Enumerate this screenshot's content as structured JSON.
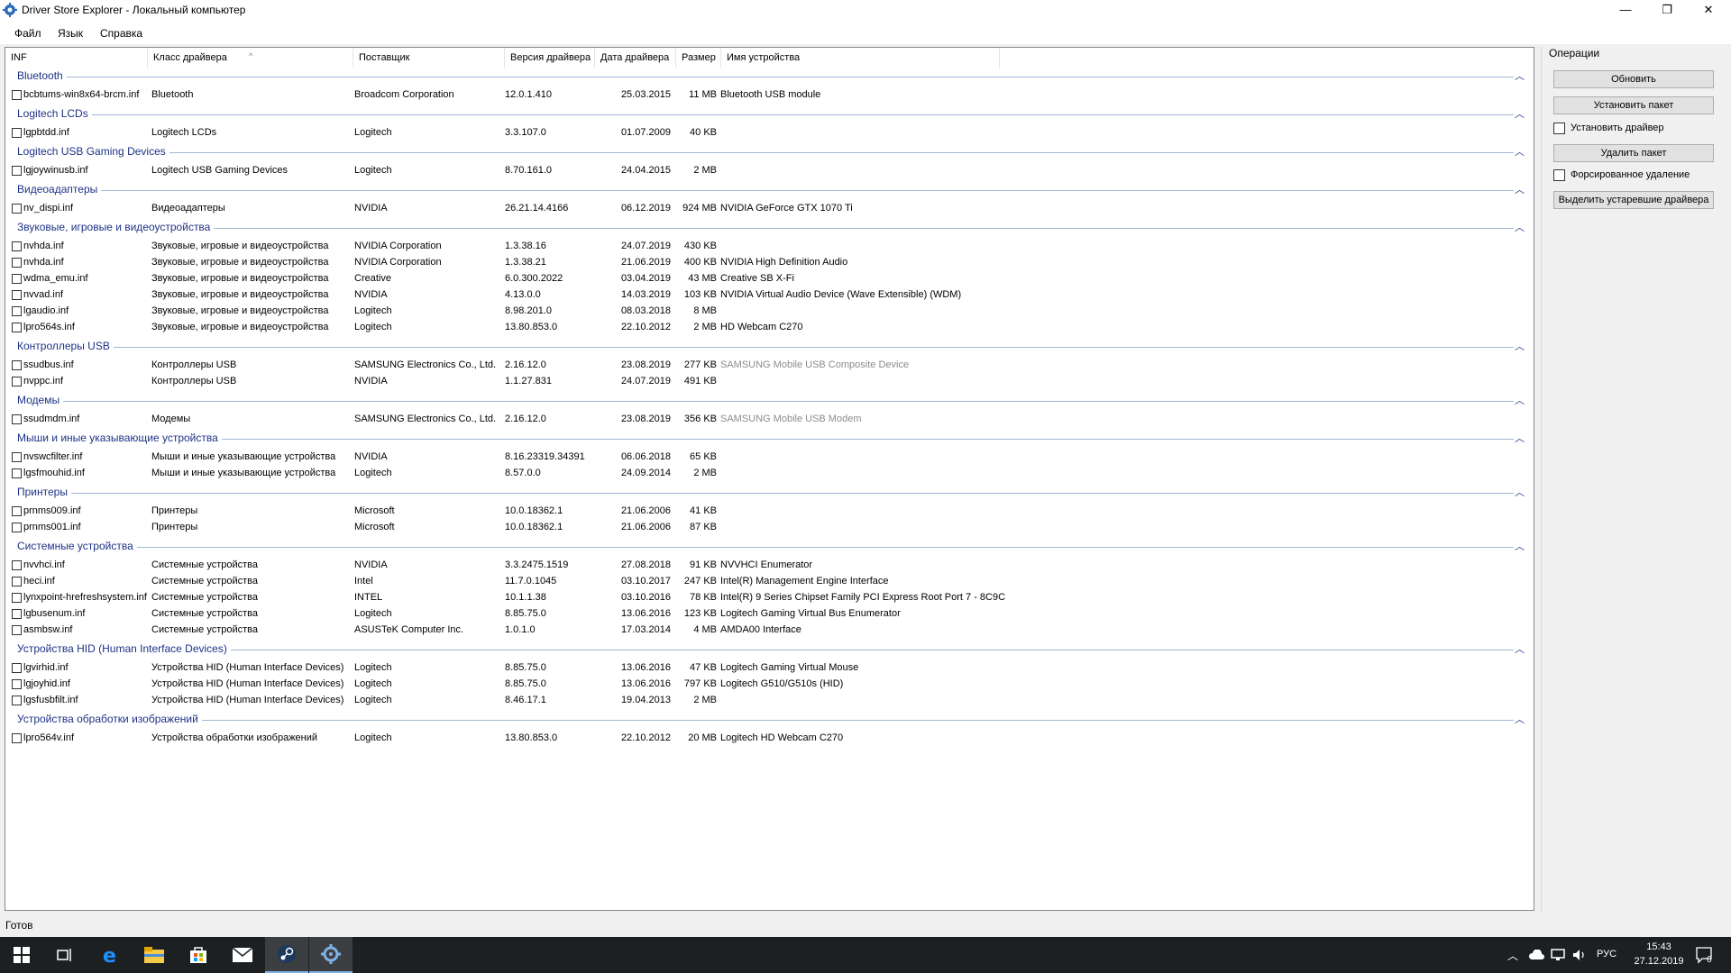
{
  "window": {
    "title": "Driver Store Explorer - Локальный компьютер",
    "min": "—",
    "max": "❐",
    "close": "✕"
  },
  "menu": [
    "Файл",
    "Язык",
    "Справка"
  ],
  "columns": [
    "INF",
    "Класс драйвера",
    "Поставщик",
    "Версия драйвера",
    "Дата драйвера",
    "Размер",
    "Имя устройства"
  ],
  "groups": [
    {
      "title": "Bluetooth",
      "rows": [
        {
          "inf": "bcbtums-win8x64-brcm.inf",
          "cls": "Bluetooth",
          "prov": "Broadcom Corporation",
          "ver": "12.0.1.410",
          "date": "25.03.2015",
          "size": "11 MB",
          "dev": "Bluetooth USB module",
          "dim": false
        }
      ]
    },
    {
      "title": "Logitech LCDs",
      "rows": [
        {
          "inf": "lgpbtdd.inf",
          "cls": "Logitech LCDs",
          "prov": "Logitech",
          "ver": "3.3.107.0",
          "date": "01.07.2009",
          "size": "40 KB",
          "dev": "",
          "dim": false
        }
      ]
    },
    {
      "title": "Logitech USB Gaming Devices",
      "rows": [
        {
          "inf": "lgjoywinusb.inf",
          "cls": "Logitech USB Gaming Devices",
          "prov": "Logitech",
          "ver": "8.70.161.0",
          "date": "24.04.2015",
          "size": "2 MB",
          "dev": "",
          "dim": false
        }
      ]
    },
    {
      "title": "Видеоадаптеры",
      "rows": [
        {
          "inf": "nv_dispi.inf",
          "cls": "Видеоадаптеры",
          "prov": "NVIDIA",
          "ver": "26.21.14.4166",
          "date": "06.12.2019",
          "size": "924 MB",
          "dev": "NVIDIA GeForce GTX 1070 Ti",
          "dim": false
        }
      ]
    },
    {
      "title": "Звуковые, игровые и видеоустройства",
      "rows": [
        {
          "inf": "nvhda.inf",
          "cls": "Звуковые, игровые и видеоустройства",
          "prov": "NVIDIA Corporation",
          "ver": "1.3.38.16",
          "date": "24.07.2019",
          "size": "430 KB",
          "dev": "",
          "dim": false
        },
        {
          "inf": "nvhda.inf",
          "cls": "Звуковые, игровые и видеоустройства",
          "prov": "NVIDIA Corporation",
          "ver": "1.3.38.21",
          "date": "21.06.2019",
          "size": "400 KB",
          "dev": "NVIDIA High Definition Audio",
          "dim": false
        },
        {
          "inf": "wdma_emu.inf",
          "cls": "Звуковые, игровые и видеоустройства",
          "prov": "Creative",
          "ver": "6.0.300.2022",
          "date": "03.04.2019",
          "size": "43 MB",
          "dev": "Creative SB X-Fi",
          "dim": false
        },
        {
          "inf": "nvvad.inf",
          "cls": "Звуковые, игровые и видеоустройства",
          "prov": "NVIDIA",
          "ver": "4.13.0.0",
          "date": "14.03.2019",
          "size": "103 KB",
          "dev": "NVIDIA Virtual Audio Device (Wave Extensible) (WDM)",
          "dim": false
        },
        {
          "inf": "lgaudio.inf",
          "cls": "Звуковые, игровые и видеоустройства",
          "prov": "Logitech",
          "ver": "8.98.201.0",
          "date": "08.03.2018",
          "size": "8 MB",
          "dev": "",
          "dim": false
        },
        {
          "inf": "lpro564s.inf",
          "cls": "Звуковые, игровые и видеоустройства",
          "prov": "Logitech",
          "ver": "13.80.853.0",
          "date": "22.10.2012",
          "size": "2 MB",
          "dev": "HD Webcam C270",
          "dim": false
        }
      ]
    },
    {
      "title": "Контроллеры USB",
      "rows": [
        {
          "inf": "ssudbus.inf",
          "cls": "Контроллеры USB",
          "prov": "SAMSUNG Electronics Co., Ltd.",
          "ver": "2.16.12.0",
          "date": "23.08.2019",
          "size": "277 KB",
          "dev": "SAMSUNG Mobile USB Composite Device",
          "dim": true
        },
        {
          "inf": "nvppc.inf",
          "cls": "Контроллеры USB",
          "prov": "NVIDIA",
          "ver": "1.1.27.831",
          "date": "24.07.2019",
          "size": "491 KB",
          "dev": "",
          "dim": false
        }
      ]
    },
    {
      "title": "Модемы",
      "rows": [
        {
          "inf": "ssudmdm.inf",
          "cls": "Модемы",
          "prov": "SAMSUNG Electronics Co., Ltd.",
          "ver": "2.16.12.0",
          "date": "23.08.2019",
          "size": "356 KB",
          "dev": "SAMSUNG Mobile USB Modem",
          "dim": true
        }
      ]
    },
    {
      "title": "Мыши и иные указывающие устройства",
      "rows": [
        {
          "inf": "nvswcfilter.inf",
          "cls": "Мыши и иные указывающие устройства",
          "prov": "NVIDIA",
          "ver": "8.16.23319.34391",
          "date": "06.06.2018",
          "size": "65 KB",
          "dev": "",
          "dim": false
        },
        {
          "inf": "lgsfmouhid.inf",
          "cls": "Мыши и иные указывающие устройства",
          "prov": "Logitech",
          "ver": "8.57.0.0",
          "date": "24.09.2014",
          "size": "2 MB",
          "dev": "",
          "dim": false
        }
      ]
    },
    {
      "title": "Принтеры",
      "rows": [
        {
          "inf": "prnms009.inf",
          "cls": "Принтеры",
          "prov": "Microsoft",
          "ver": "10.0.18362.1",
          "date": "21.06.2006",
          "size": "41 KB",
          "dev": "",
          "dim": false
        },
        {
          "inf": "prnms001.inf",
          "cls": "Принтеры",
          "prov": "Microsoft",
          "ver": "10.0.18362.1",
          "date": "21.06.2006",
          "size": "87 KB",
          "dev": "",
          "dim": false
        }
      ]
    },
    {
      "title": "Системные устройства",
      "rows": [
        {
          "inf": "nvvhci.inf",
          "cls": "Системные устройства",
          "prov": "NVIDIA",
          "ver": "3.3.2475.1519",
          "date": "27.08.2018",
          "size": "91 KB",
          "dev": "NVVHCI Enumerator",
          "dim": false
        },
        {
          "inf": "heci.inf",
          "cls": "Системные устройства",
          "prov": "Intel",
          "ver": "11.7.0.1045",
          "date": "03.10.2017",
          "size": "247 KB",
          "dev": "Intel(R) Management Engine Interface",
          "dim": false
        },
        {
          "inf": "lynxpoint-hrefreshsystem.inf",
          "cls": "Системные устройства",
          "prov": "INTEL",
          "ver": "10.1.1.38",
          "date": "03.10.2016",
          "size": "78 KB",
          "dev": "Intel(R) 9 Series Chipset Family PCI Express Root Port 7 - 8C9C",
          "dim": false
        },
        {
          "inf": "lgbusenum.inf",
          "cls": "Системные устройства",
          "prov": "Logitech",
          "ver": "8.85.75.0",
          "date": "13.06.2016",
          "size": "123 KB",
          "dev": "Logitech Gaming Virtual Bus Enumerator",
          "dim": false
        },
        {
          "inf": "asmbsw.inf",
          "cls": "Системные устройства",
          "prov": "ASUSTeK Computer Inc.",
          "ver": "1.0.1.0",
          "date": "17.03.2014",
          "size": "4 MB",
          "dev": "AMDA00 Interface",
          "dim": false
        }
      ]
    },
    {
      "title": "Устройства HID (Human Interface Devices)",
      "rows": [
        {
          "inf": "lgvirhid.inf",
          "cls": "Устройства HID (Human Interface Devices)",
          "prov": "Logitech",
          "ver": "8.85.75.0",
          "date": "13.06.2016",
          "size": "47 KB",
          "dev": "Logitech Gaming Virtual Mouse",
          "dim": false
        },
        {
          "inf": "lgjoyhid.inf",
          "cls": "Устройства HID (Human Interface Devices)",
          "prov": "Logitech",
          "ver": "8.85.75.0",
          "date": "13.06.2016",
          "size": "797 KB",
          "dev": "Logitech G510/G510s (HID)",
          "dim": false
        },
        {
          "inf": "lgsfusbfilt.inf",
          "cls": "Устройства HID (Human Interface Devices)",
          "prov": "Logitech",
          "ver": "8.46.17.1",
          "date": "19.04.2013",
          "size": "2 MB",
          "dev": "",
          "dim": false
        }
      ]
    },
    {
      "title": "Устройства обработки изображений",
      "rows": [
        {
          "inf": "lpro564v.inf",
          "cls": "Устройства обработки изображений",
          "prov": "Logitech",
          "ver": "13.80.853.0",
          "date": "22.10.2012",
          "size": "20 MB",
          "dev": "Logitech HD Webcam C270",
          "dim": false
        }
      ]
    }
  ],
  "sidebar": {
    "title": "Операции",
    "refresh": "Обновить",
    "install_package": "Установить пакет",
    "install_driver": "Установить драйвер",
    "delete_package": "Удалить пакет",
    "force_delete": "Форсированное удаление",
    "select_old": "Выделить устаревшие драйвера"
  },
  "status": "Готов",
  "taskbar": {
    "lang": "РУС",
    "time": "15:43",
    "date": "27.12.2019",
    "notif_count": "6"
  },
  "colors": {
    "group_title": "#1e3287",
    "group_line": "#a3b6d7",
    "taskbar": "#1d2022"
  }
}
